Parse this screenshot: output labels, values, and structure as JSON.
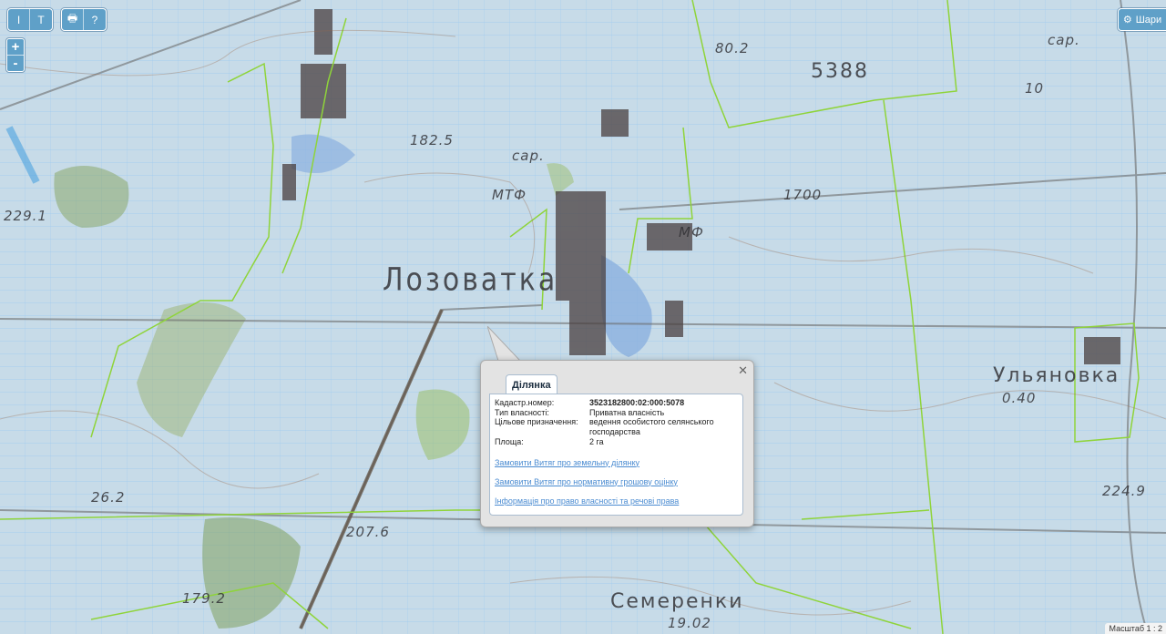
{
  "toolbar": {
    "group1": [
      {
        "icon": "measure-distance-icon",
        "glyph": "I"
      },
      {
        "icon": "measure-area-icon",
        "glyph": "T"
      }
    ],
    "group2": [
      {
        "icon": "print-icon",
        "glyph": "🖶"
      },
      {
        "icon": "identify-cursor-icon",
        "glyph": "?"
      }
    ]
  },
  "zoom": {
    "in_label": "+",
    "out_label": "-"
  },
  "layers_button": {
    "label": "Шари",
    "icon": "gear-icon"
  },
  "map_labels": {
    "village_main": "Лозоватка",
    "village_east": "Ульяновка",
    "village_south": "Семеренки",
    "elev_1": "5388",
    "elev_2": "80.2",
    "elev_3": "182.5",
    "elev_4": "229.1",
    "elev_5": "26.2",
    "elev_6": "207.6",
    "elev_7": "224.9",
    "elev_8": "0.40",
    "elev_9": "19.02",
    "elev_10": "179.2",
    "farm_1": "МТФ",
    "farm_2": "МФ",
    "barn": "сар.",
    "num_1": "10",
    "num_2": "1700"
  },
  "popup": {
    "tab_label": "Ділянка",
    "fields": [
      {
        "key": "Кадастр.номер:",
        "value": "3523182800:02:000:5078",
        "bold": true
      },
      {
        "key": "Тип власності:",
        "value": "Приватна власність",
        "bold": false
      },
      {
        "key": "Цільове призначення:",
        "value": "ведення особистого селянського господарства",
        "bold": false
      },
      {
        "key": "Площа:",
        "value": "2 га",
        "bold": false
      }
    ],
    "links": [
      "Замовити Витяг про земельну ділянку",
      "Замовити Витяг про нормативну грошову оцінку",
      "Інформація про право власності та речові права"
    ]
  },
  "scale": {
    "label": "Масштаб 1 : 2"
  },
  "colors": {
    "parcel_lines": "#7cc3f2",
    "boundary_green": "#8fd43a",
    "toolbar_blue": "#5fa0c8",
    "link_blue": "#4a8bd1"
  }
}
